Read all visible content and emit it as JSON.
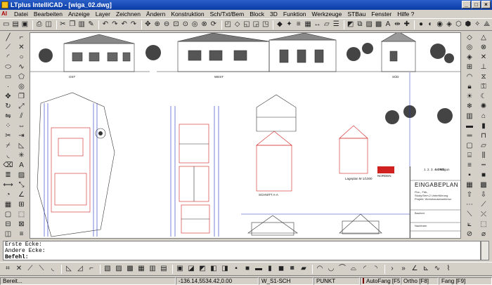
{
  "window": {
    "title": "LTplus IntelliCAD - [wiga_02.dwg]"
  },
  "menu": {
    "logo": "AI",
    "items": [
      "Datei",
      "Bearbeiten",
      "Anzeige",
      "Layer",
      "Zeichnen",
      "Ändern",
      "Konstruktion",
      "Sch/Txt/Bem",
      "Block",
      "3D",
      "Funktion",
      "Werkzeuge",
      "STBau",
      "Fenster",
      "Hilfe ?"
    ]
  },
  "drawing": {
    "views": [
      "OST",
      "WEST",
      "SÜD",
      "NORD"
    ],
    "section_label": "SCHNITT A-A",
    "site_plan_label": "Lageplan M 1/1000",
    "logo_text": "NORDEN",
    "sheet_index": "1. 2. 3. 4. Fertigun",
    "plan_title": "EINGABEPLAN",
    "plan_lines": [
      "Flur-, Fdk.,",
      "Study/Sem.2 Unterführung",
      "Projekt: Wohnhauserweiterun"
    ],
    "client_label": "Bauherr",
    "owner_label": "Nachbarn"
  },
  "command": {
    "lines": [
      "Erste Ecke:",
      "Andere Ecke:"
    ],
    "prompt": "Befehl:"
  },
  "status": {
    "ready": "Bereit...",
    "coords": "-136.14,5534.42,0.00",
    "layer": "W_S1-SCH",
    "point_style": "PUNKT",
    "autofang": "AutoFang [F5]",
    "ortho": "Ortho [F8]",
    "fang": "Fang [F9]"
  }
}
